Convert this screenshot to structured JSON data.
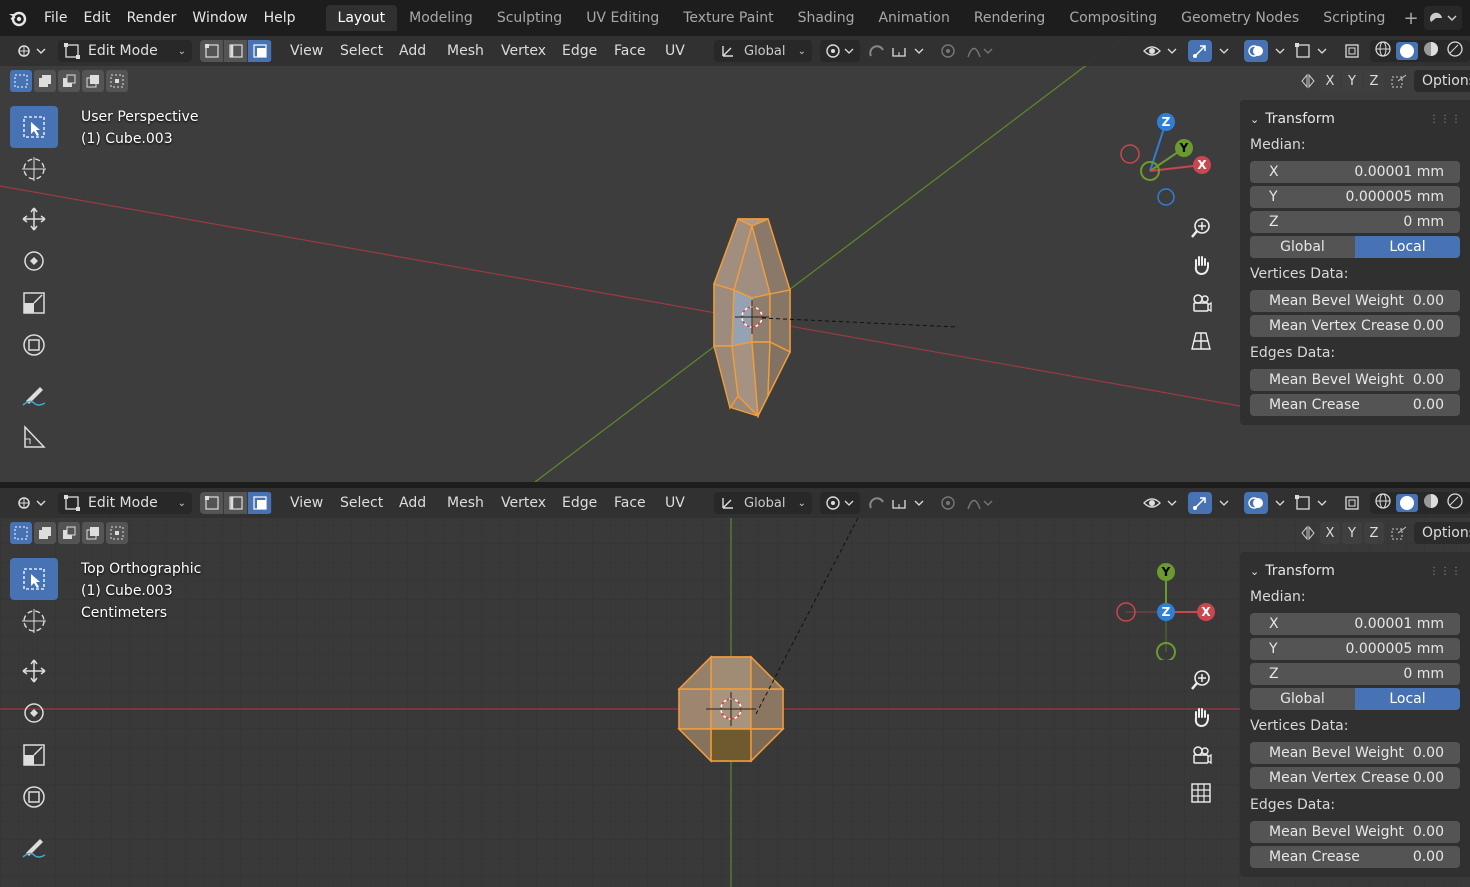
{
  "menu": {
    "items": [
      "File",
      "Edit",
      "Render",
      "Window",
      "Help"
    ]
  },
  "workspaces": [
    "Layout",
    "Modeling",
    "Sculpting",
    "UV Editing",
    "Texture Paint",
    "Shading",
    "Animation",
    "Rendering",
    "Compositing",
    "Geometry Nodes",
    "Scripting"
  ],
  "header": {
    "mode": "Edit Mode",
    "menus": [
      "View",
      "Select",
      "Add",
      "Mesh",
      "Vertex",
      "Edge",
      "Face",
      "UV"
    ],
    "orientation": "Global",
    "options_label": "Options",
    "axes": [
      "X",
      "Y",
      "Z"
    ]
  },
  "viewport_top": {
    "view_name": "User Perspective",
    "object": "(1) Cube.003",
    "units": ""
  },
  "viewport_bottom": {
    "view_name": "Top Orthographic",
    "object": "(1) Cube.003",
    "units": "Centimeters"
  },
  "gizmo": {
    "z": "Z",
    "y": "Y",
    "x": "X"
  },
  "npanel": {
    "title": "Transform",
    "median_label": "Median:",
    "fields": [
      {
        "axis": "X",
        "value": "0.00001 mm"
      },
      {
        "axis": "Y",
        "value": "0.000005 mm"
      },
      {
        "axis": "Z",
        "value": "0 mm"
      }
    ],
    "space": {
      "global": "Global",
      "local": "Local",
      "active": "Local"
    },
    "vertices_label": "Vertices Data:",
    "vertices": [
      {
        "label": "Mean Bevel Weight",
        "value": "0.00"
      },
      {
        "label": "Mean Vertex Crease",
        "value": "0.00"
      }
    ],
    "edges_label": "Edges Data:",
    "edges": [
      {
        "label": "Mean Bevel Weight",
        "value": "0.00"
      },
      {
        "label": "Mean Crease",
        "value": "0.00"
      }
    ]
  },
  "colors": {
    "accent": "#4772b3",
    "selected": "#f29d3a",
    "axis_x": "#c9474f",
    "axis_y": "#6b9b2e",
    "axis_z": "#2f7fd6"
  }
}
